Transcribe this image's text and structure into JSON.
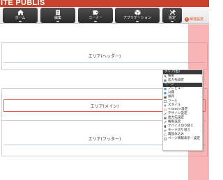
{
  "app": {
    "brand": "ITE PUBLIS"
  },
  "toolbar": {
    "buttons": [
      {
        "label": "ホーム",
        "icon": "home-icon"
      },
      {
        "label": "編集",
        "icon": "edit-icon"
      },
      {
        "label": "コーナー",
        "icon": "corner-icon"
      },
      {
        "label": "アプリケーション",
        "icon": "application-icon"
      },
      {
        "label": "設定",
        "icon": "settings-icon"
      }
    ],
    "right": {
      "label": "保存設定",
      "icon": "close-icon"
    }
  },
  "areas": {
    "header": "エリア(ヘッダー)",
    "main": "エリア(メイン)",
    "footer": "エリア(フッター)"
  },
  "context_menu": {
    "area_section": "エリア(右)",
    "area_items": [
      {
        "label": "検索",
        "icon": "search-icon",
        "submenu": true
      },
      {
        "label": "出力先設定",
        "icon": "output-icon",
        "submenu": false
      }
    ],
    "page_section": "ページ",
    "page_items": [
      {
        "label": "プレビュー",
        "icon": "preview-icon",
        "submenu": true
      },
      {
        "label": "公開",
        "icon": "publish-icon",
        "submenu": true
      },
      {
        "label": "保存",
        "icon": "save-icon",
        "submenu": true
      },
      {
        "label": "ツール",
        "icon": "tool-icon",
        "submenu": false
      },
      {
        "label": "スタイル",
        "icon": "style-icon",
        "submenu": false
      },
      {
        "label": "<head>設定",
        "icon": "head-icon",
        "submenu": false
      },
      {
        "label": "デザイン設定",
        "icon": "design-icon",
        "submenu": false
      },
      {
        "label": "出力先設定",
        "icon": "output-icon",
        "submenu": false
      },
      {
        "label": "権限設定",
        "icon": "permission-icon",
        "submenu": false
      },
      {
        "label": "デバイス切り替え",
        "icon": "device-icon",
        "submenu": true
      },
      {
        "label": "モード切り替え",
        "icon": "mode-icon",
        "submenu": true
      },
      {
        "label": "再読み込み",
        "icon": "reload-icon",
        "submenu": false
      },
      {
        "label": "ページ情報表示・設定",
        "icon": "info-icon",
        "submenu": false
      }
    ]
  },
  "colors": {
    "brand": "#c9412a",
    "toolbar_button": "#333333",
    "main_area_border": "#e45a3c",
    "highlight": "#f47878",
    "menu_section": "#3a3a3a"
  }
}
